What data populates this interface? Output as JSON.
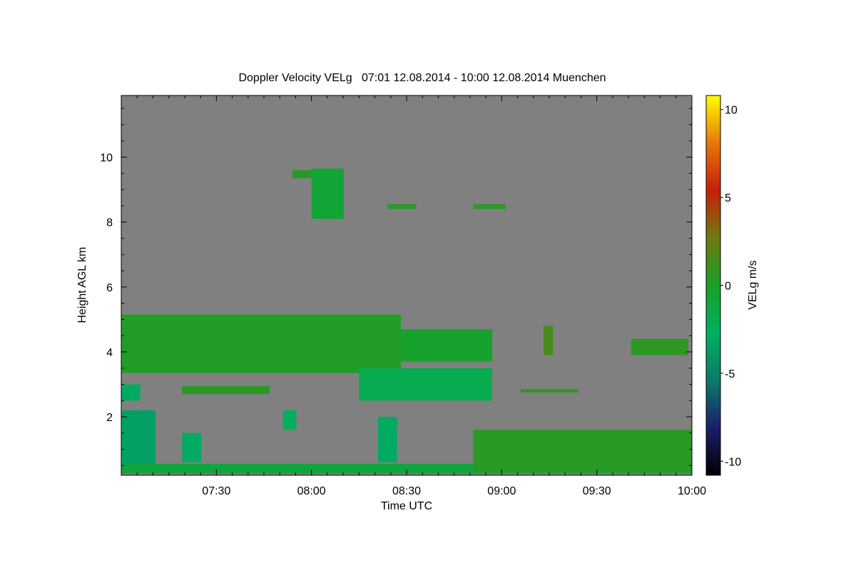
{
  "chart_data": {
    "type": "heatmap",
    "title": "Doppler Velocity VELg   07:01 12.08.2014 - 10:00 12.08.2014 Muenchen",
    "xlabel": "Time UTC",
    "ylabel": "Height AGL km",
    "x_range": [
      "07:01",
      "10:00"
    ],
    "xlim": [
      7.0,
      10.0
    ],
    "ylim": [
      0.2,
      11.9
    ],
    "x_ticks": [
      {
        "value": 7.5,
        "label": "07:30"
      },
      {
        "value": 8.0,
        "label": "08:00"
      },
      {
        "value": 8.5,
        "label": "08:30"
      },
      {
        "value": 9.0,
        "label": "09:00"
      },
      {
        "value": 9.5,
        "label": "09:30"
      },
      {
        "value": 10.0,
        "label": "10:00"
      }
    ],
    "y_ticks": [
      {
        "value": 2,
        "label": "2"
      },
      {
        "value": 4,
        "label": "4"
      },
      {
        "value": 6,
        "label": "6"
      },
      {
        "value": 8,
        "label": "8"
      },
      {
        "value": 10,
        "label": "10"
      }
    ],
    "colorbar": {
      "label": "VELg m/s",
      "range": [
        -10.8,
        10.8
      ],
      "ticks": [
        {
          "value": 10,
          "label": "10"
        },
        {
          "value": 5,
          "label": "5"
        },
        {
          "value": 0,
          "label": "0"
        },
        {
          "value": -5,
          "label": "-5"
        },
        {
          "value": -10,
          "label": "-10"
        }
      ],
      "colors": [
        "#000000",
        "#1a1f6e",
        "#0b7a6a",
        "#00b060",
        "#1aa028",
        "#6e7a10",
        "#c81e0a",
        "#e87808",
        "#ffff00"
      ]
    },
    "background_color": "#808080",
    "regions": [
      {
        "t0": 7.0,
        "t1": 8.47,
        "h0": 3.35,
        "h1": 5.15,
        "v": 0.3
      },
      {
        "t0": 8.47,
        "t1": 8.95,
        "h0": 3.7,
        "h1": 4.7,
        "v": -0.3
      },
      {
        "t0": 8.25,
        "t1": 8.95,
        "h0": 2.5,
        "h1": 3.5,
        "v": -2.0
      },
      {
        "t0": 7.32,
        "t1": 7.78,
        "h0": 2.7,
        "h1": 2.95,
        "v": 0.5
      },
      {
        "t0": 7.0,
        "t1": 7.1,
        "h0": 2.5,
        "h1": 3.0,
        "v": -3.0
      },
      {
        "t0": 7.0,
        "t1": 7.18,
        "h0": 0.3,
        "h1": 2.2,
        "v": -3.5
      },
      {
        "t0": 7.0,
        "t1": 10.0,
        "h0": 0.25,
        "h1": 0.55,
        "v": -1.0
      },
      {
        "t0": 8.85,
        "t1": 10.0,
        "h0": 0.3,
        "h1": 1.6,
        "v": 0.5
      },
      {
        "t0": 7.9,
        "t1": 8.0,
        "h0": 9.35,
        "h1": 9.6,
        "v": 0.4
      },
      {
        "t0": 8.0,
        "t1": 8.17,
        "h0": 8.1,
        "h1": 9.65,
        "v": -0.7
      },
      {
        "t0": 8.4,
        "t1": 8.55,
        "h0": 8.4,
        "h1": 8.55,
        "v": 0.5
      },
      {
        "t0": 8.85,
        "t1": 9.02,
        "h0": 8.4,
        "h1": 8.55,
        "v": 0.4
      },
      {
        "t0": 9.68,
        "t1": 9.98,
        "h0": 3.9,
        "h1": 4.4,
        "v": 0.6
      },
      {
        "t0": 9.22,
        "t1": 9.27,
        "h0": 3.9,
        "h1": 4.8,
        "v": 1.5
      },
      {
        "t0": 9.1,
        "t1": 9.4,
        "h0": 2.75,
        "h1": 2.85,
        "v": 0.8
      },
      {
        "t0": 7.85,
        "t1": 7.92,
        "h0": 1.6,
        "h1": 2.2,
        "v": -2.5
      },
      {
        "t0": 8.35,
        "t1": 8.45,
        "h0": 0.6,
        "h1": 2.0,
        "v": -3.0
      },
      {
        "t0": 7.32,
        "t1": 7.42,
        "h0": 0.6,
        "h1": 1.5,
        "v": -3.0
      }
    ]
  }
}
